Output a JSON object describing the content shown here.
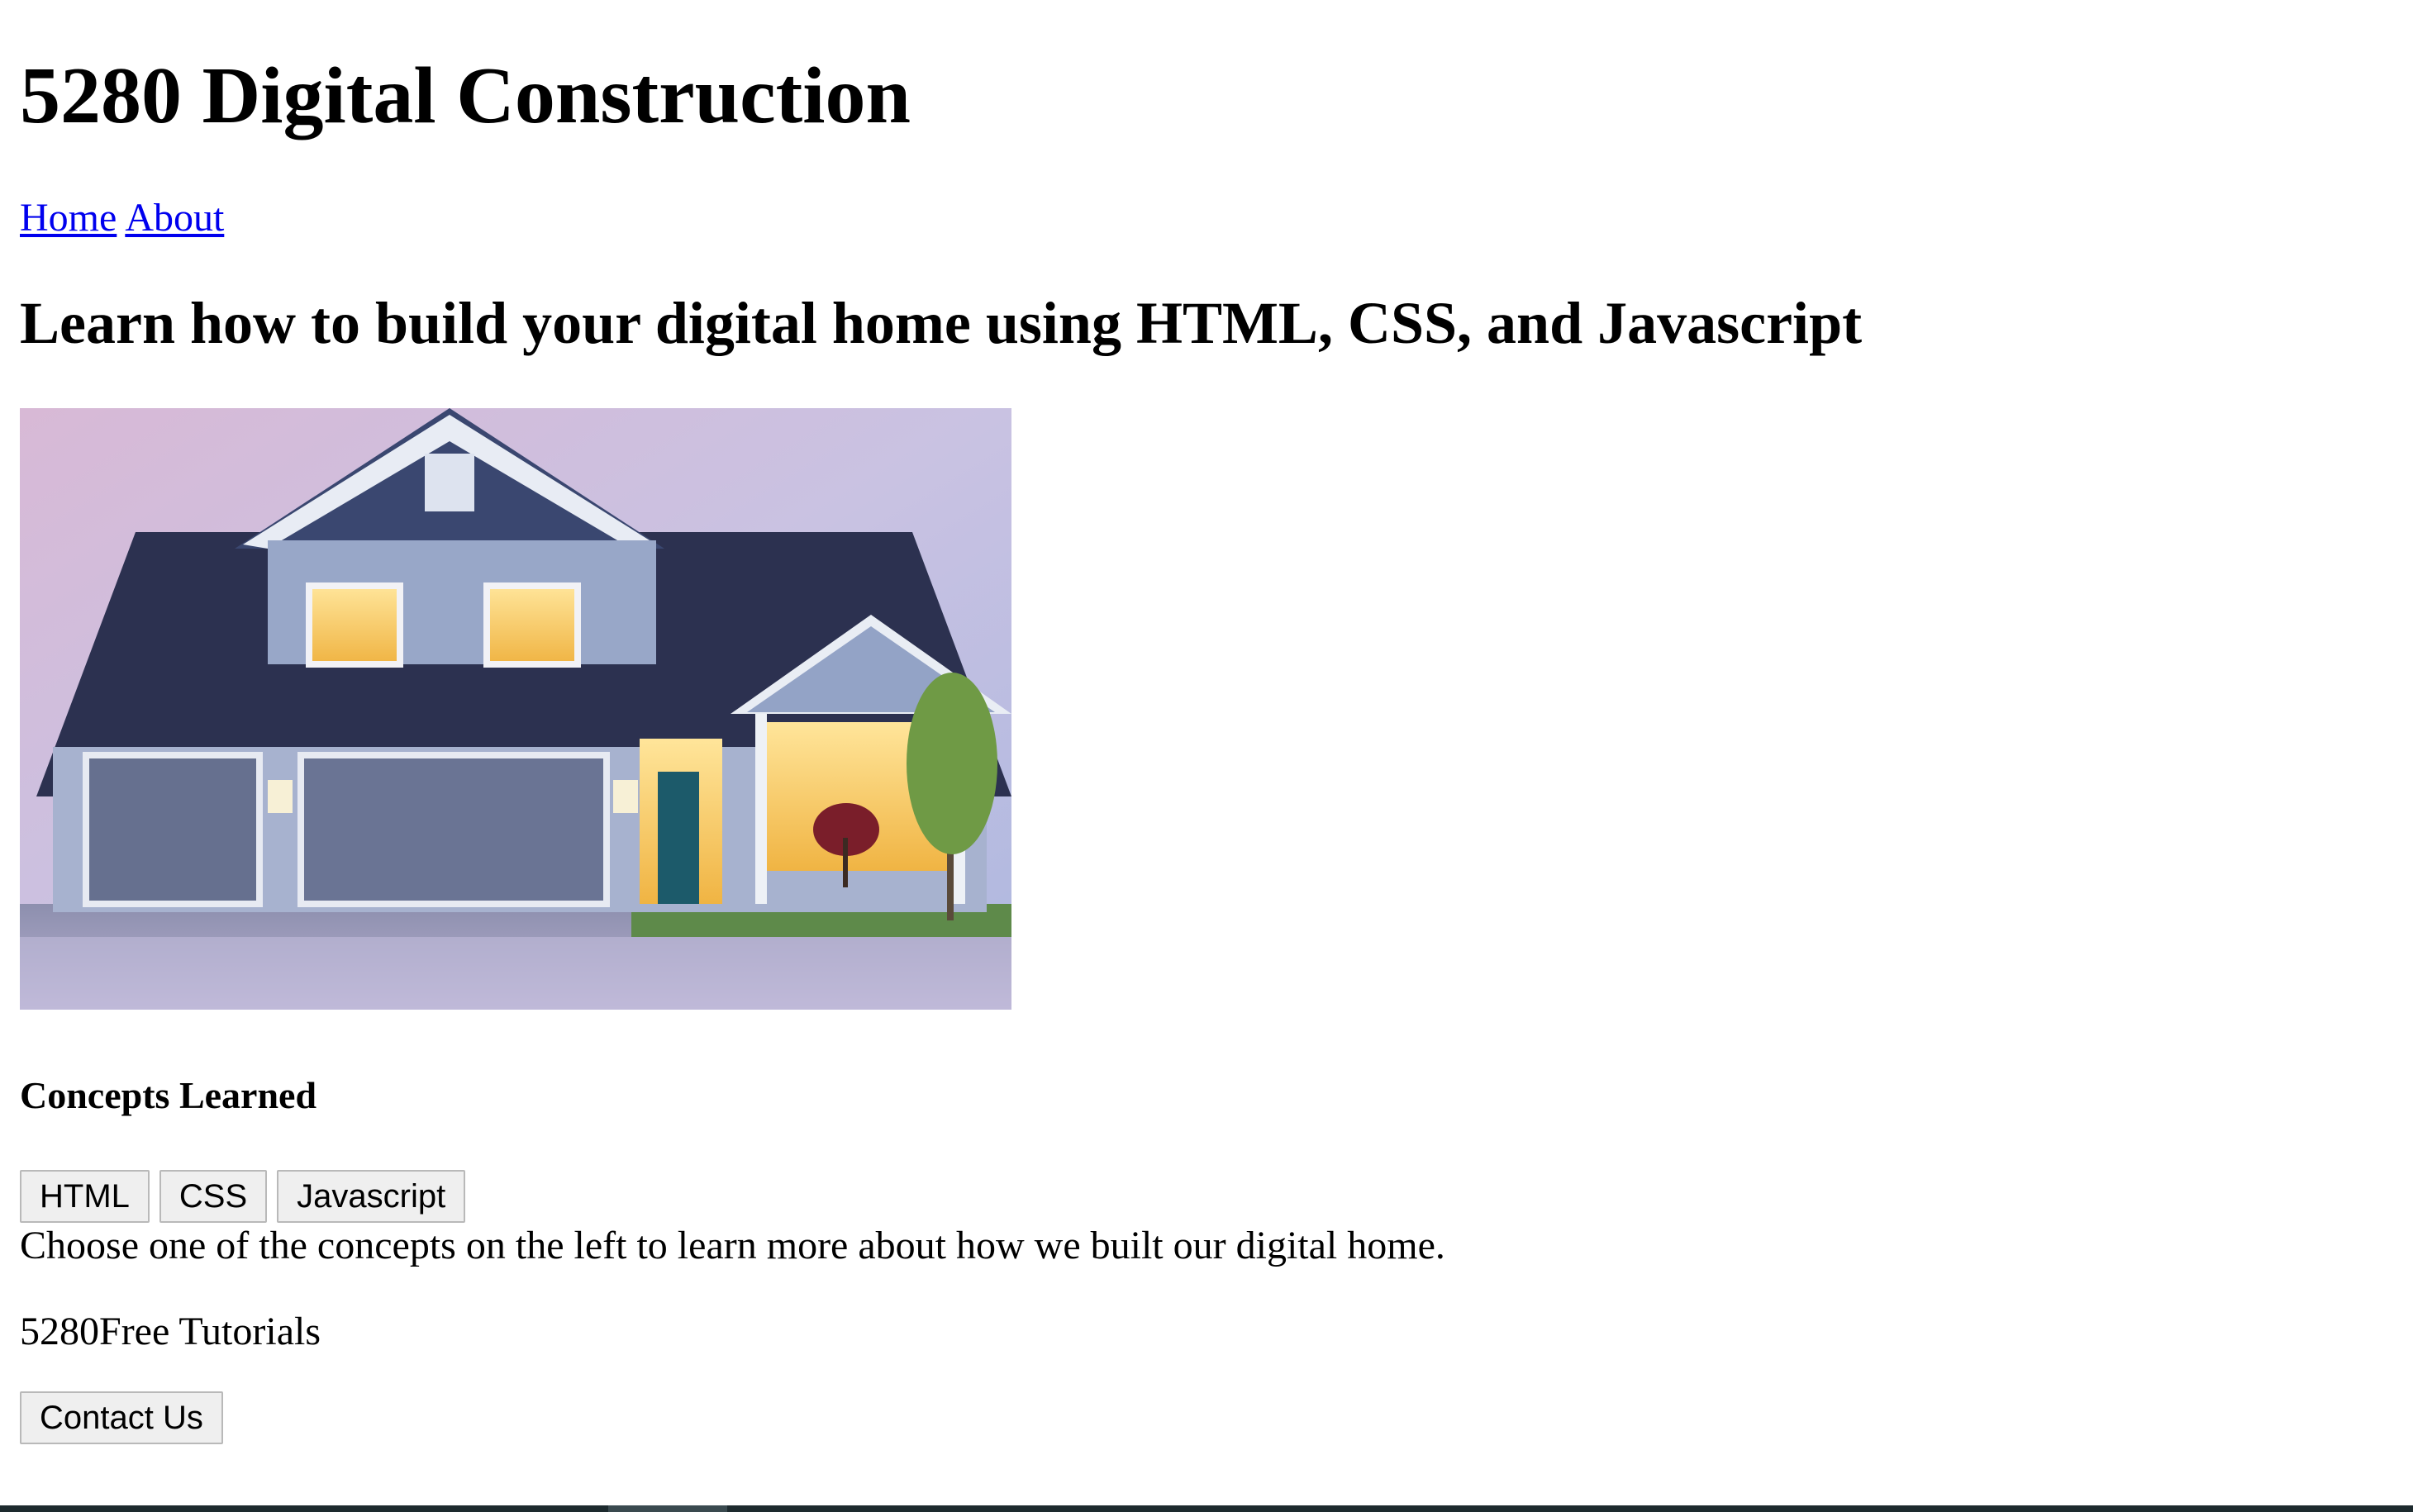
{
  "site": {
    "title": "5280 Digital Construction"
  },
  "nav": {
    "home_label": "Home",
    "about_label": "About"
  },
  "hero": {
    "tagline": "Learn how to build your digital home using HTML, CSS, and Javascript"
  },
  "concepts": {
    "title": "Concepts Learned",
    "buttons": [
      "HTML",
      "CSS",
      "Javascript"
    ],
    "description": "Choose one of the concepts on the left to learn more about how we built our digital home."
  },
  "footer": {
    "text": "5280Free Tutorials",
    "contact_label": "Contact Us"
  },
  "colors": {
    "link": "#0000ee",
    "button_bg": "#efefef",
    "button_border": "#b9b9b9"
  }
}
